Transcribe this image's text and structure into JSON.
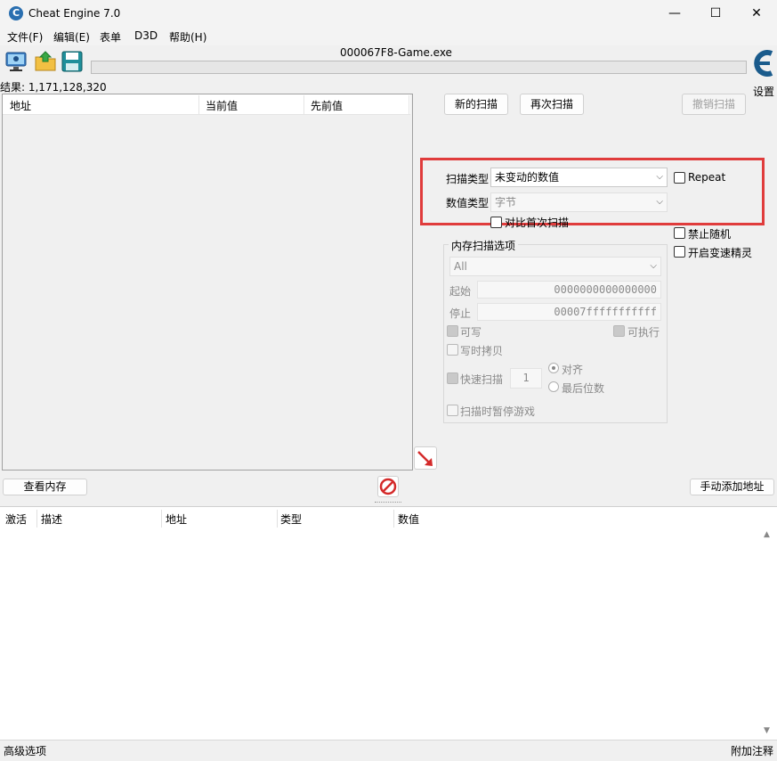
{
  "window": {
    "title": "Cheat Engine 7.0",
    "icon": "cheat-engine-logo-icon",
    "minimize_glyph": "—",
    "maximize_glyph": "☐",
    "close_glyph": "✕"
  },
  "menu": {
    "items": [
      "文件(F)",
      "编辑(E)",
      "表单",
      "D3D",
      "帮助(H)"
    ]
  },
  "toolbar": {
    "icons": [
      "select-process-icon",
      "open-file-icon",
      "save-file-icon"
    ],
    "process_title": "000067F8-Game.exe",
    "settings_label": "设置"
  },
  "results": {
    "label": "结果: 1,171,128,320"
  },
  "found_list": {
    "columns": [
      "地址",
      "当前值",
      "先前值"
    ]
  },
  "scan_buttons": {
    "new_scan": "新的扫描",
    "next_scan": "再次扫描",
    "undo_scan": "撤销扫描"
  },
  "scan_options": {
    "scan_type_label": "扫描类型",
    "scan_type_value": "未变动的数值",
    "repeat_label": "Repeat",
    "value_type_label": "数值类型",
    "value_type_value": "字节",
    "compare_first_label": "对比首次扫描",
    "accent_color": "#e03c3c"
  },
  "right_options": {
    "disable_random_label": "禁止随机",
    "speedhack_label": "开启变速精灵"
  },
  "memory_options": {
    "group_label": "内存扫描选项",
    "region_value": "All",
    "start_label": "起始",
    "start_value": "0000000000000000",
    "stop_label": "停止",
    "stop_value": "00007fffffffffff",
    "writable_label": "可写",
    "executable_label": "可执行",
    "copy_on_write_label": "写时拷贝",
    "fast_scan_label": "快速扫描",
    "fast_scan_value": "1",
    "align_label": "对齐",
    "last_digits_label": "最后位数",
    "pause_game_label": "扫描时暂停游戏"
  },
  "middle_bar": {
    "view_memory": "查看内存",
    "add_address": "手动添加地址"
  },
  "address_list": {
    "columns": [
      "激活",
      "描述",
      "地址",
      "类型",
      "数值"
    ]
  },
  "status": {
    "left": "高级选项",
    "right": "附加注释"
  }
}
